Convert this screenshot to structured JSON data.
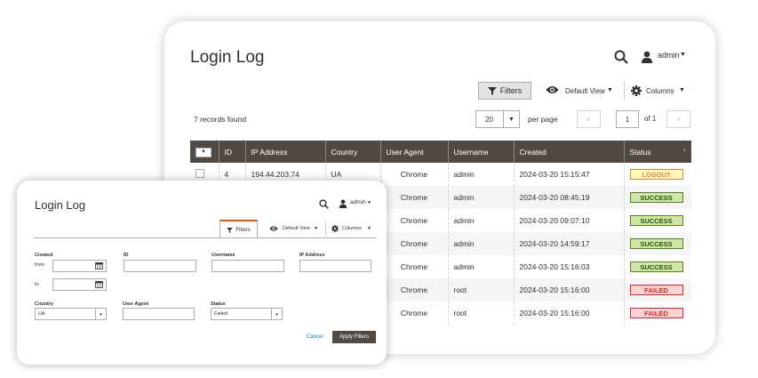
{
  "main": {
    "title": "Login Log",
    "header": {
      "admin_label": "admin"
    },
    "toolbar": {
      "filters_label": "Filters",
      "default_view_label": "Default View",
      "columns_label": "Columns"
    },
    "records_found": "7 records found",
    "per_page": {
      "value": "20",
      "label": "per page"
    },
    "pagination": {
      "page": "1",
      "of_label": "of 1"
    },
    "columns": [
      "ID",
      "IP Address",
      "Country",
      "User Agent",
      "Username",
      "Created",
      "Status"
    ],
    "rows": [
      {
        "id": "4",
        "ip": "194.44.203.74",
        "country": "UA",
        "agent": "Chrome",
        "username": "admin",
        "created": "2024-03-20 15:15:47",
        "status": "LOGOUT"
      },
      {
        "id": "",
        "ip": "",
        "country": "",
        "agent": "Chrome",
        "username": "admin",
        "created": "2024-03-20 08:45:19",
        "status": "SUCCESS"
      },
      {
        "id": "",
        "ip": "",
        "country": "",
        "agent": "Chrome",
        "username": "admin",
        "created": "2024-03-20 09:07:10",
        "status": "SUCCESS"
      },
      {
        "id": "",
        "ip": "",
        "country": "",
        "agent": "Chrome",
        "username": "admin",
        "created": "2024-03-20 14:59:17",
        "status": "SUCCESS"
      },
      {
        "id": "",
        "ip": "",
        "country": "",
        "agent": "Chrome",
        "username": "admin",
        "created": "2024-03-20 15:16:03",
        "status": "SUCCESS"
      },
      {
        "id": "",
        "ip": "",
        "country": "",
        "agent": "Chrome",
        "username": "root",
        "created": "2024-03-20 15:16:00",
        "status": "FAILED"
      },
      {
        "id": "",
        "ip": "",
        "country": "",
        "agent": "Chrome",
        "username": "root",
        "created": "2024-03-20 15:16:00",
        "status": "FAILED"
      }
    ]
  },
  "filters_panel": {
    "title": "Login Log",
    "admin_label": "admin",
    "filters_tab": "Filters",
    "default_view_label": "Default View",
    "columns_label": "Columns",
    "created_label": "Created",
    "from_label": "from",
    "to_label": "to",
    "id_label": "ID",
    "username_label": "Username",
    "ip_label": "IP Address",
    "country_label": "Country",
    "country_value": "UA",
    "user_agent_label": "User Agent",
    "status_label": "Status",
    "status_value": "Failed",
    "cancel_label": "Cancel",
    "apply_label": "Apply Filters"
  },
  "colors": {
    "grid_header": "#514943",
    "accent": "#eb5202",
    "link": "#007bdb"
  }
}
